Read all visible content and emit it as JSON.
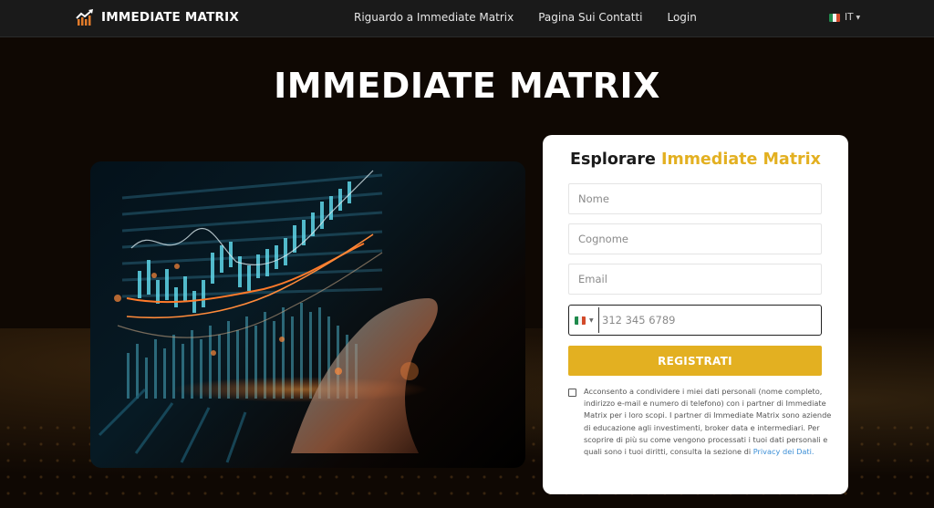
{
  "header": {
    "logo_text": "IMMEDIATE MATRIX",
    "logo_icon": "chart-growth-icon",
    "nav": [
      {
        "label": "Riguardo a Immediate Matrix"
      },
      {
        "label": "Pagina Sui Contatti"
      },
      {
        "label": "Login"
      }
    ],
    "language": {
      "code": "IT",
      "flag": "italy-flag-icon"
    }
  },
  "hero": {
    "title": "IMMEDIATE MATRIX",
    "image_alt": "Trading chart hologram over laptop with hand"
  },
  "form": {
    "title_prefix": "Esplorare",
    "title_accent": "Immediate Matrix",
    "first_name_placeholder": "Nome",
    "last_name_placeholder": "Cognome",
    "email_placeholder": "Email",
    "phone_placeholder": "312 345 6789",
    "phone_country": "IT",
    "submit_label": "REGISTRATI",
    "consent_text": "Acconsento a condividere i miei dati personali (nome completo, indirizzo e-mail e numero di telefono) con i partner di Immediate Matrix per i loro scopi. I partner di Immediate Matrix sono aziende di educazione agli investimenti, broker data e intermediari. Per scoprire di più su come vengono processati i tuoi dati personali e quali sono i tuoi diritti, consulta la sezione di ",
    "consent_link": "Privacy dei Dati.",
    "consent_checked": false
  },
  "colors": {
    "accent": "#e3b021",
    "header_bg": "#1a1a1a",
    "page_bg": "#0f0803",
    "link": "#3c8fd6"
  }
}
